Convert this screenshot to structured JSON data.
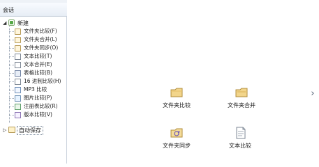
{
  "left_panel": {
    "header_title": "会话",
    "root": {
      "label": "新建",
      "expanded_symbol": "◢"
    },
    "items": [
      {
        "label": "文件夹比较(F)",
        "icon": "folder-compare-icon"
      },
      {
        "label": "文件夹合并(L)",
        "icon": "folder-merge-icon"
      },
      {
        "label": "文件夹同步(O)",
        "icon": "folder-sync-icon"
      },
      {
        "label": "文本比较(T)",
        "icon": "text-compare-icon"
      },
      {
        "label": "文本合并(E)",
        "icon": "text-merge-icon"
      },
      {
        "label": "表格比较(B)",
        "icon": "table-compare-icon"
      },
      {
        "label": "16 进制比较(H)",
        "icon": "hex-compare-icon"
      },
      {
        "label": "MP3 比较",
        "icon": "mp3-compare-icon"
      },
      {
        "label": "图片比较(P)",
        "icon": "picture-compare-icon"
      },
      {
        "label": "注册表比较(R)",
        "icon": "registry-compare-icon"
      },
      {
        "label": "版本比较(V)",
        "icon": "version-compare-icon"
      }
    ],
    "autosave": {
      "label": "自动保存",
      "collapsed_symbol": "▷"
    }
  },
  "main": {
    "tiles": [
      {
        "label": "文件夹比较",
        "icon": "folder-compare-icon"
      },
      {
        "label": "文件夹合并",
        "icon": "folder-merge-icon"
      },
      {
        "label": "文件夹同步",
        "icon": "folder-sync-icon"
      },
      {
        "label": "文本比较",
        "icon": "text-compare-icon"
      }
    ],
    "next_arrow": "›"
  }
}
